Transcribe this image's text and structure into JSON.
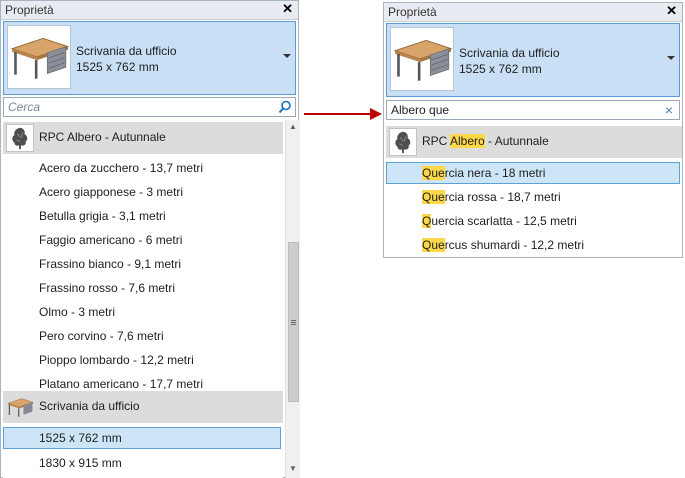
{
  "left": {
    "title": "Proprietà",
    "close_glyph": "✕",
    "type": {
      "name": "Scrivania da ufficio",
      "size": "1525 x 762 mm",
      "thumb_icon": "desk-icon"
    },
    "search": {
      "value": "",
      "placeholder": "Cerca",
      "icon": "search-icon"
    },
    "groups": [
      {
        "label": "RPC Albero - Autunnale",
        "icon": "tree-icon",
        "items": [
          "Acero da zucchero - 13,7 metri",
          "Acero giapponese - 3 metri",
          "Betulla grigia - 3,1 metri",
          "Faggio americano - 6 metri",
          "Frassino bianco - 9,1 metri",
          "Frassino rosso - 7,6 metri",
          "Olmo - 3 metri",
          "Pero corvino - 7,6 metri",
          "Pioppo lombardo - 12,2 metri",
          "Platano americano - 17,7 metri"
        ]
      },
      {
        "label": "Scrivania da ufficio",
        "icon": "desk-icon",
        "items": [
          "1525 x 762 mm",
          "1830 x 915 mm"
        ],
        "selected_index": 0
      }
    ]
  },
  "right": {
    "title": "Proprietà",
    "close_glyph": "✕",
    "type": {
      "name": "Scrivania da ufficio",
      "size": "1525 x 762 mm",
      "thumb_icon": "desk-icon"
    },
    "search": {
      "value": "Albero que",
      "placeholder": "Cerca",
      "clear_glyph": "×"
    },
    "group": {
      "label_pre": "RPC ",
      "label_match": "Albero",
      "label_post": " - Autunnale",
      "icon": "tree-icon"
    },
    "results": [
      {
        "match": "Que",
        "rest": "rcia nera - 18 metri",
        "selected": true
      },
      {
        "match": "Que",
        "rest": "rcia rossa - 18,7 metri",
        "selected": false
      },
      {
        "match": "Q",
        "rest": "uercia scarlatta - 12,5 metri",
        "selected": false
      },
      {
        "match": "Que",
        "rest": "rcus shumardi - 12,2 metri",
        "selected": false
      }
    ]
  },
  "colors": {
    "highlight": "#ffd84a",
    "selection": "#cde6f7",
    "arrow": "#c00000",
    "type_bg": "#c9dff5"
  }
}
